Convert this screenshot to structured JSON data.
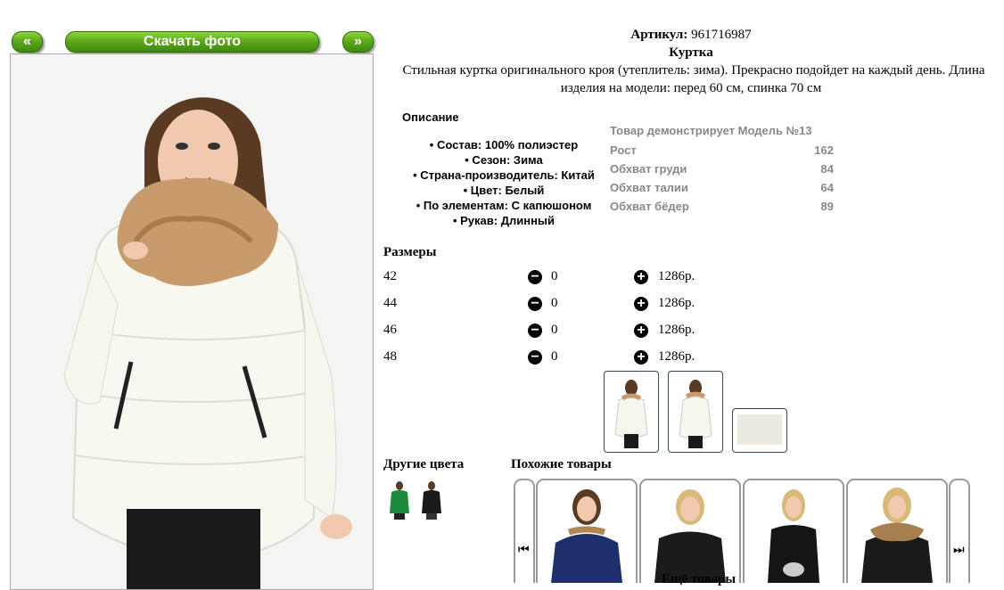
{
  "nav": {
    "prev_label": "«",
    "download_label": "Скачать фото",
    "next_label": "»"
  },
  "product": {
    "article_label": "Артикул:",
    "article_value": "961716987",
    "name": "Куртка",
    "description_line1": "Стильная куртка оригинального кроя (утеплитель: зима). Прекрасно подойдет на каждый день. Длина",
    "description_line2": "изделия на модели: перед 60 см, спинка 70 см"
  },
  "details": {
    "heading": "Описание",
    "items": [
      "• Состав: 100% полиэстер",
      "• Сезон: Зима",
      "• Страна-производитель: Китай",
      "• Цвет: Белый",
      "• По элементам: С капюшоном",
      "• Рукав: Длинный"
    ]
  },
  "model": {
    "heading": "Товар демонстрирует Модель №13",
    "rows": [
      {
        "label": "Рост",
        "value": "162"
      },
      {
        "label": "Обхват груди",
        "value": "84"
      },
      {
        "label": "Обхват талии",
        "value": "64"
      },
      {
        "label": "Обхват бёдер",
        "value": "89"
      }
    ]
  },
  "sizes": {
    "heading": "Размеры",
    "rows": [
      {
        "size": "42",
        "qty": "0",
        "price": "1286р."
      },
      {
        "size": "44",
        "qty": "0",
        "price": "1286р."
      },
      {
        "size": "46",
        "qty": "0",
        "price": "1286р."
      },
      {
        "size": "48",
        "qty": "0",
        "price": "1286р."
      }
    ],
    "minus_icon": "−",
    "plus_icon": "+"
  },
  "other_colors": {
    "heading": "Другие цвета",
    "swatches": [
      "#1e8a3e",
      "#1a1a1a"
    ]
  },
  "similar": {
    "heading": "Похожие товары",
    "prev_icon": "⏮",
    "next_icon": "⏭",
    "jacket_colors": [
      "#1e2f6e",
      "#1b1b1b",
      "#151515",
      "#1a1a1a"
    ],
    "more_label": "Ещё товары"
  }
}
